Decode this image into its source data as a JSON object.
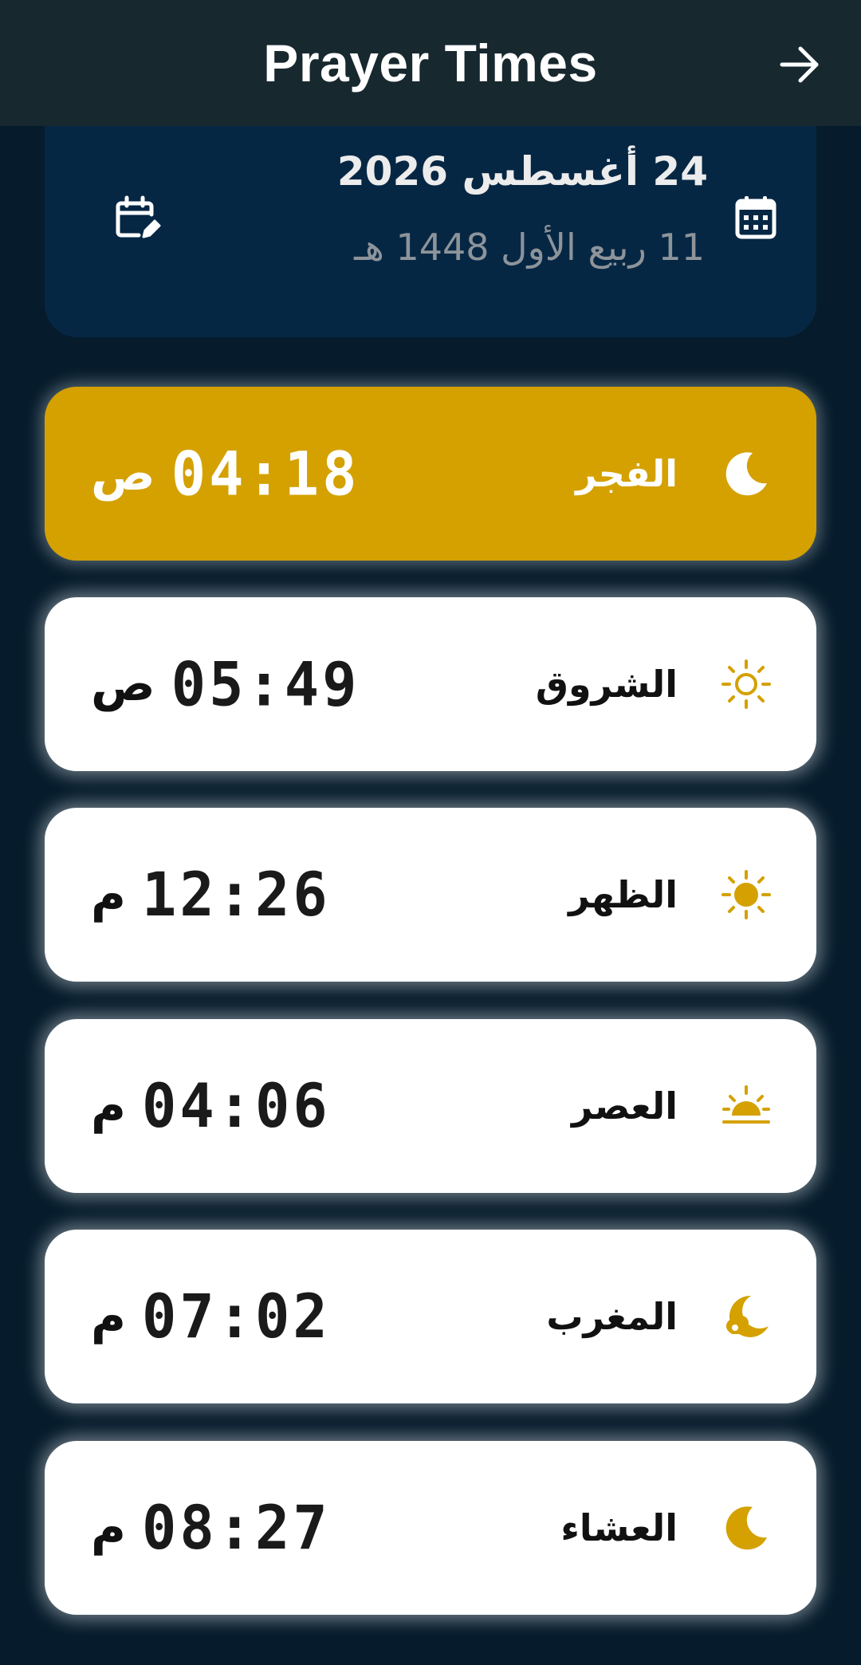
{
  "app_bar": {
    "title": "Prayer Times",
    "forward_icon": "arrow-right-icon"
  },
  "date_card": {
    "gregorian": "24 أغسطس 2026",
    "hijri": "11 ربيع الأول 1448 هـ",
    "edit_icon": "calendar-edit-icon",
    "calendar_icon": "calendar-icon"
  },
  "prayers": [
    {
      "name": "الفجر",
      "time": "04:18",
      "period": "ص",
      "icon": "crescent-moon-icon",
      "active": true
    },
    {
      "name": "الشروق",
      "time": "05:49",
      "period": "ص",
      "icon": "sun-outline-icon",
      "active": false
    },
    {
      "name": "الظهر",
      "time": "12:26",
      "period": "م",
      "icon": "sun-icon",
      "active": false
    },
    {
      "name": "العصر",
      "time": "04:06",
      "period": "م",
      "icon": "sunset-icon",
      "active": false
    },
    {
      "name": "المغرب",
      "time": "07:02",
      "period": "م",
      "icon": "moon-cloud-icon",
      "active": false
    },
    {
      "name": "العشاء",
      "time": "08:27",
      "period": "م",
      "icon": "crescent-moon-icon",
      "active": false
    }
  ],
  "colors": {
    "background": "#061c2c",
    "app_bar": "#18282f",
    "date_card": "#062744",
    "accent_gold": "#d4a100",
    "card": "#ffffff"
  }
}
